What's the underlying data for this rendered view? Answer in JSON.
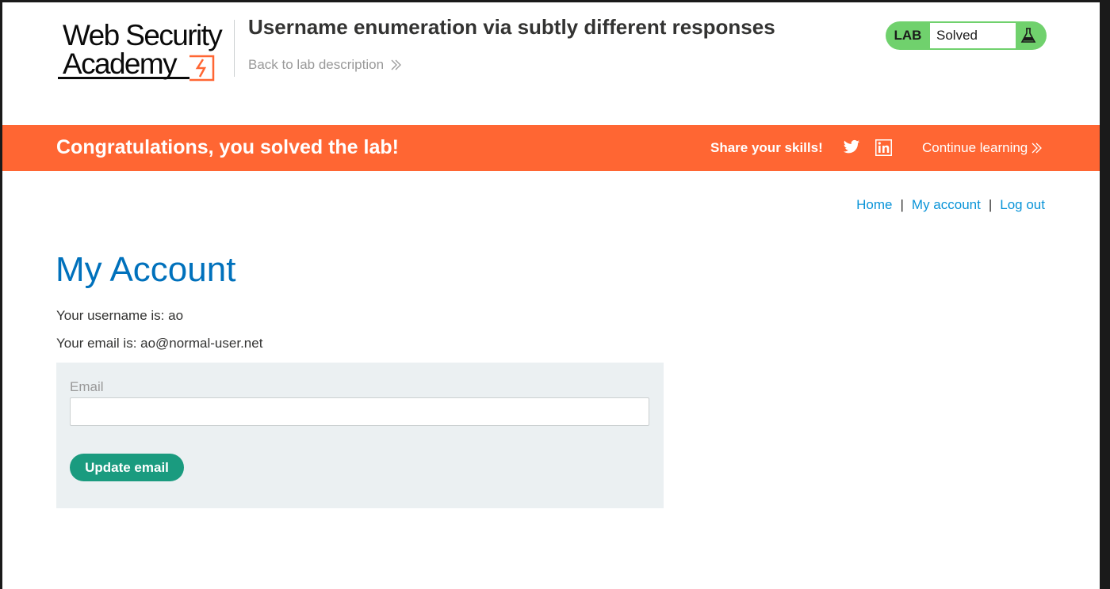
{
  "header": {
    "logo_line1": "Web Security",
    "logo_line2": "Academy",
    "lab_title": "Username enumeration via subtly different responses",
    "back_link": "Back to lab description",
    "lab_status": {
      "label": "LAB",
      "state": "Solved",
      "icon": "flask-icon"
    }
  },
  "banner": {
    "message": "Congratulations, you solved the lab!",
    "share_label": "Share your skills!",
    "share_icons": [
      "twitter-icon",
      "linkedin-icon"
    ],
    "continue_label": "Continue learning"
  },
  "nav": {
    "home": "Home",
    "sep1": "|",
    "my_account": "My account",
    "sep2": "|",
    "logout": "Log out"
  },
  "main": {
    "title": "My Account",
    "username_line": "Your username is: ao",
    "email_line": "Your email is: ao@normal-user.net",
    "form": {
      "email_label": "Email",
      "email_value": "",
      "submit_label": "Update email"
    }
  },
  "colors": {
    "banner": "#ff6633",
    "lab_badge": "#70d16d",
    "title_blue": "#0071bc",
    "link_blue": "#0a94d8",
    "button_green": "#1a9b7f",
    "form_bg": "#ebf0f2"
  }
}
